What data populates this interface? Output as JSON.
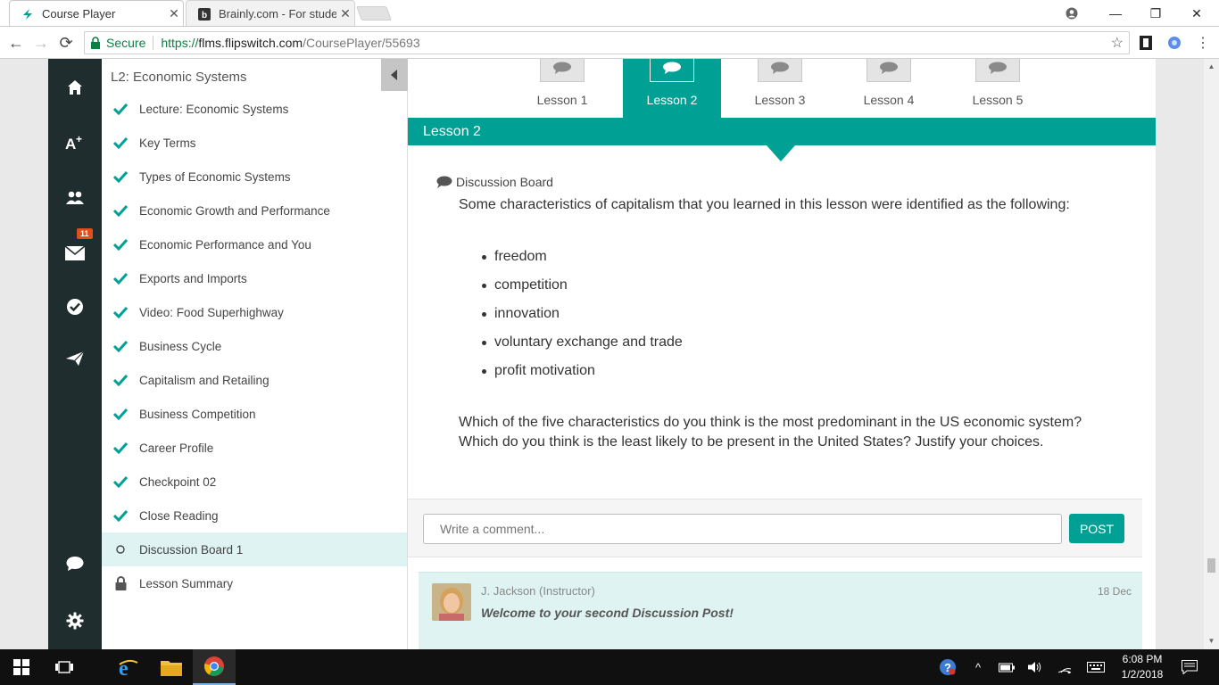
{
  "browser": {
    "tabs": [
      {
        "title": "Course Player",
        "active": true
      },
      {
        "title": "Brainly.com - For studen",
        "active": false
      }
    ],
    "secure_label": "Secure",
    "url_scheme": "https://",
    "url_host": "flms.flipswitch.com",
    "url_path": "/CoursePlayer/55693"
  },
  "leftnav": {
    "messages_badge": "11"
  },
  "outline": {
    "title": "L2: Economic Systems",
    "items": [
      {
        "label": "Lecture: Economic Systems",
        "status": "complete"
      },
      {
        "label": "Key Terms",
        "status": "complete"
      },
      {
        "label": "Types of Economic Systems",
        "status": "complete"
      },
      {
        "label": "Economic Growth and Performance",
        "status": "complete"
      },
      {
        "label": "Economic Performance and You",
        "status": "complete"
      },
      {
        "label": "Exports and Imports",
        "status": "complete"
      },
      {
        "label": "Video: Food Superhighway",
        "status": "complete"
      },
      {
        "label": "Business Cycle",
        "status": "complete"
      },
      {
        "label": "Capitalism and Retailing",
        "status": "complete"
      },
      {
        "label": "Business Competition",
        "status": "complete"
      },
      {
        "label": "Career Profile",
        "status": "complete"
      },
      {
        "label": "Checkpoint 02",
        "status": "complete"
      },
      {
        "label": "Close Reading",
        "status": "complete"
      },
      {
        "label": "Discussion Board 1",
        "status": "current"
      },
      {
        "label": "Lesson Summary",
        "status": "locked"
      }
    ]
  },
  "lessons": {
    "tabs": [
      "Lesson 1",
      "Lesson 2",
      "Lesson 3",
      "Lesson 4",
      "Lesson 5"
    ],
    "active_index": 1,
    "bar_title": "Lesson 2"
  },
  "discussion": {
    "heading": "Discussion Board",
    "prompt": "Some characteristics of capitalism that you learned in this lesson were identified as the following:",
    "characteristics": [
      "freedom",
      "competition",
      "innovation",
      "voluntary exchange and trade",
      "profit motivation"
    ],
    "question": "Which of the five characteristics do you think is the most predominant in the US economic system? Which do you think is the least likely to be present in the United States? Justify your choices.",
    "comment_placeholder": "Write a comment...",
    "post_label": "POST"
  },
  "post": {
    "author": "J. Jackson (Instructor)",
    "date": "18 Dec",
    "text": "Welcome to your second Discussion Post!"
  },
  "taskbar": {
    "time": "6:08 PM",
    "date": "1/2/2018"
  },
  "colors": {
    "accent": "#00a094",
    "nav_dark": "#1f2d2e",
    "current_item_bg": "#dff3f3"
  }
}
